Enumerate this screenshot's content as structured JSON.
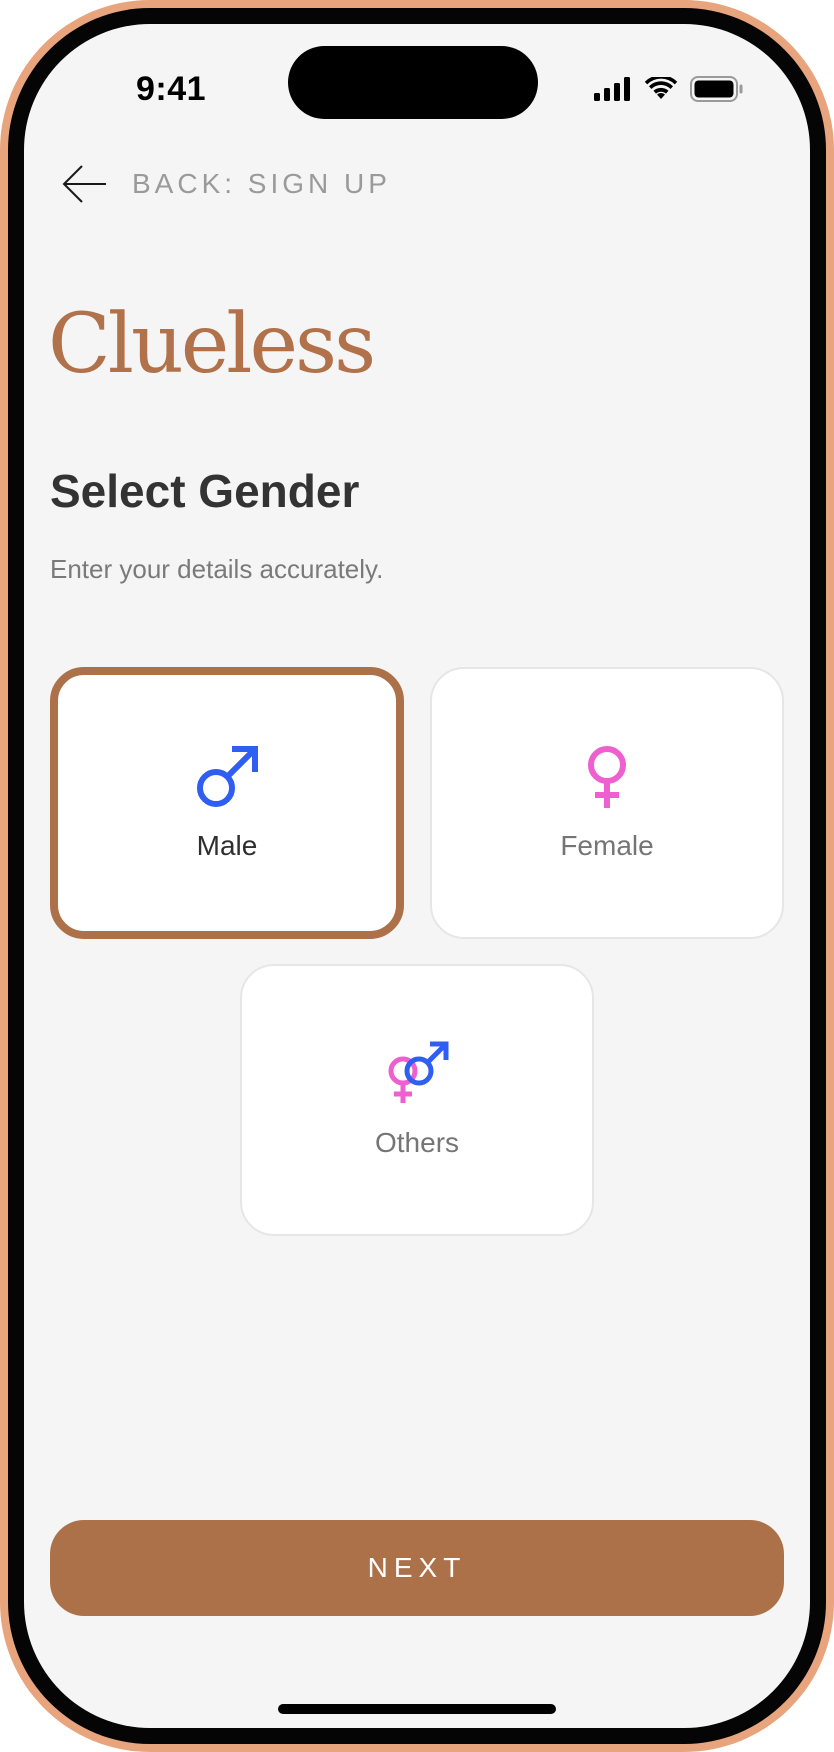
{
  "status_bar": {
    "time": "9:41"
  },
  "nav": {
    "back_label": "BACK: SIGN UP",
    "back_icon": "arrow-left-icon"
  },
  "brand": {
    "logo_text": "Clueless",
    "accent_color": "#ad714a"
  },
  "page": {
    "title": "Select Gender",
    "subtitle": "Enter your details accurately."
  },
  "options": [
    {
      "label": "Male",
      "icon": "male-symbol-icon",
      "selected": true
    },
    {
      "label": "Female",
      "icon": "female-symbol-icon",
      "selected": false
    },
    {
      "label": "Others",
      "icon": "gender-symbols-icon",
      "selected": false
    }
  ],
  "colors": {
    "male": "#2f5ef0",
    "female": "#ee5fd0"
  },
  "footer": {
    "next_label": "NEXT"
  }
}
